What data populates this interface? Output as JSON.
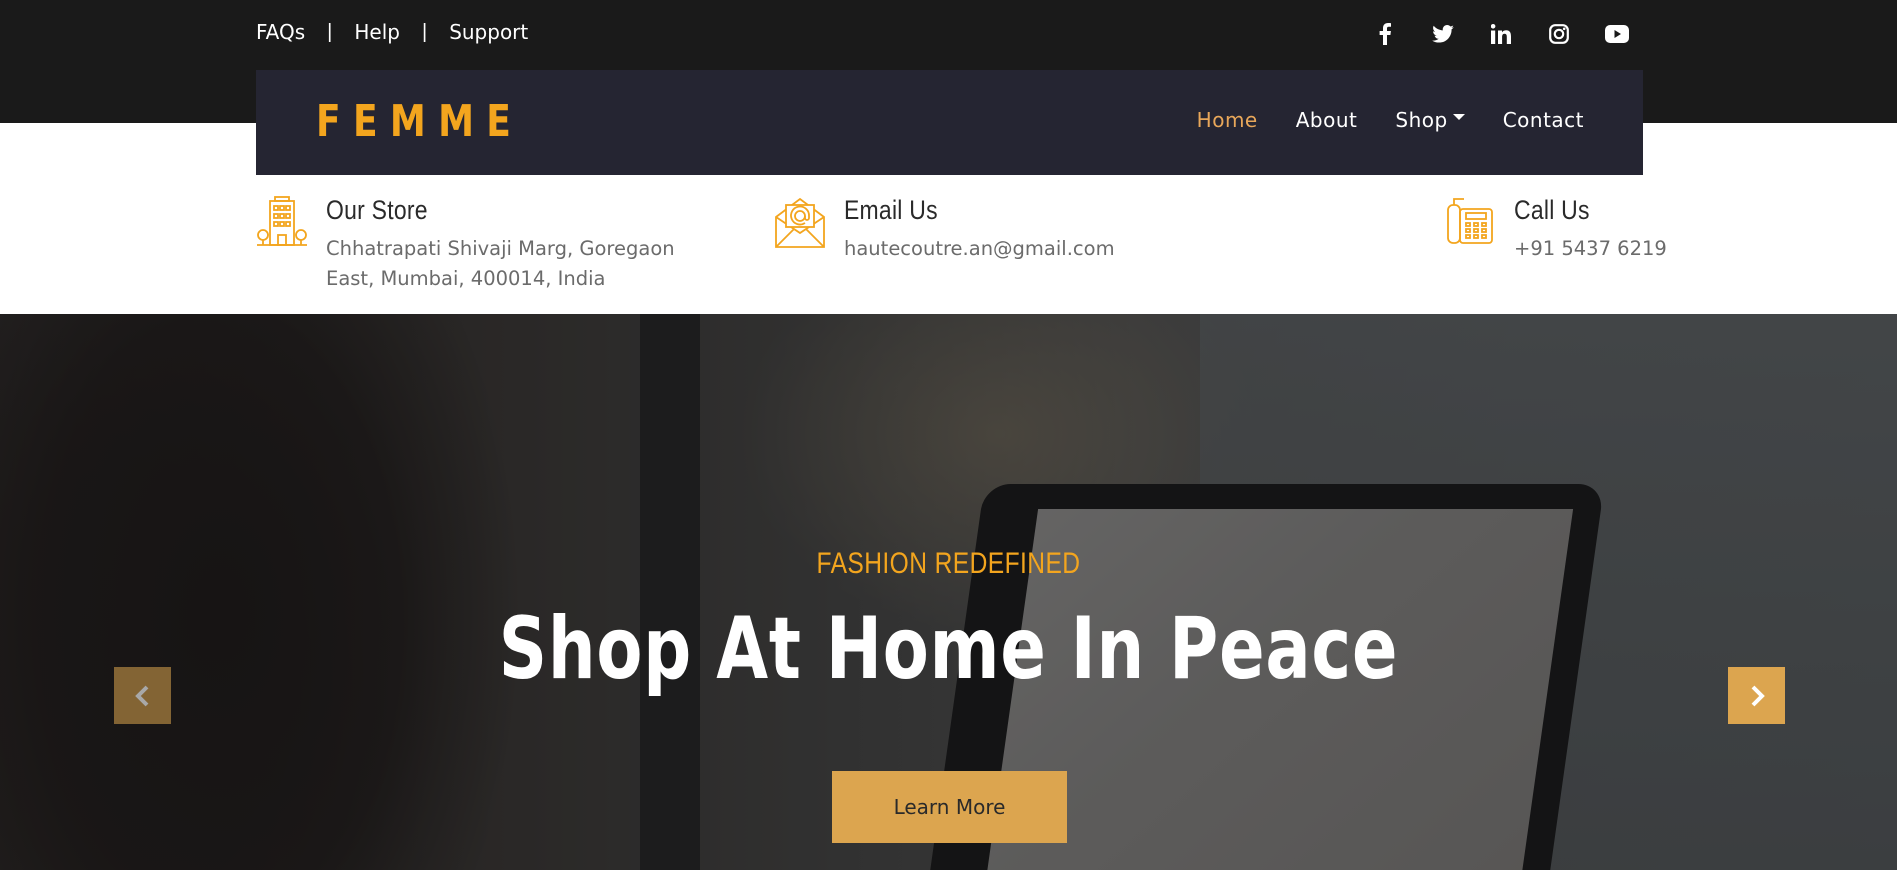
{
  "topbar": {
    "links": [
      "FAQs",
      "Help",
      "Support"
    ],
    "separator": "|",
    "social_icons": [
      "facebook-icon",
      "twitter-icon",
      "linkedin-icon",
      "instagram-icon",
      "youtube-icon"
    ]
  },
  "brand": {
    "logo": "FEMME",
    "accent": "#f3a51e"
  },
  "nav": {
    "items": [
      {
        "label": "Home",
        "active": true
      },
      {
        "label": "About",
        "active": false
      },
      {
        "label": "Shop",
        "active": false,
        "dropdown": true
      },
      {
        "label": "Contact",
        "active": false
      }
    ]
  },
  "info": {
    "store": {
      "title": "Our Store",
      "line1": "Chhatrapati Shivaji Marg, Goregaon",
      "line2": "East, Mumbai, 400014, India",
      "icon": "building-icon"
    },
    "email": {
      "title": "Email Us",
      "value": "hautecoutre.an@gmail.com",
      "icon": "envelope-icon"
    },
    "call": {
      "title": "Call Us",
      "value": "+91 5437 6219",
      "icon": "phone-icon"
    }
  },
  "hero": {
    "subtitle": "FASHION REDEFINED",
    "title": "Shop At Home In Peace",
    "button": "Learn More",
    "prev_icon": "chevron-left-icon",
    "next_icon": "chevron-right-icon"
  },
  "colors": {
    "dark": "#1a1a1a",
    "navbar": "#252532",
    "gold": "#dca54f",
    "active_nav": "#e8a75a"
  }
}
